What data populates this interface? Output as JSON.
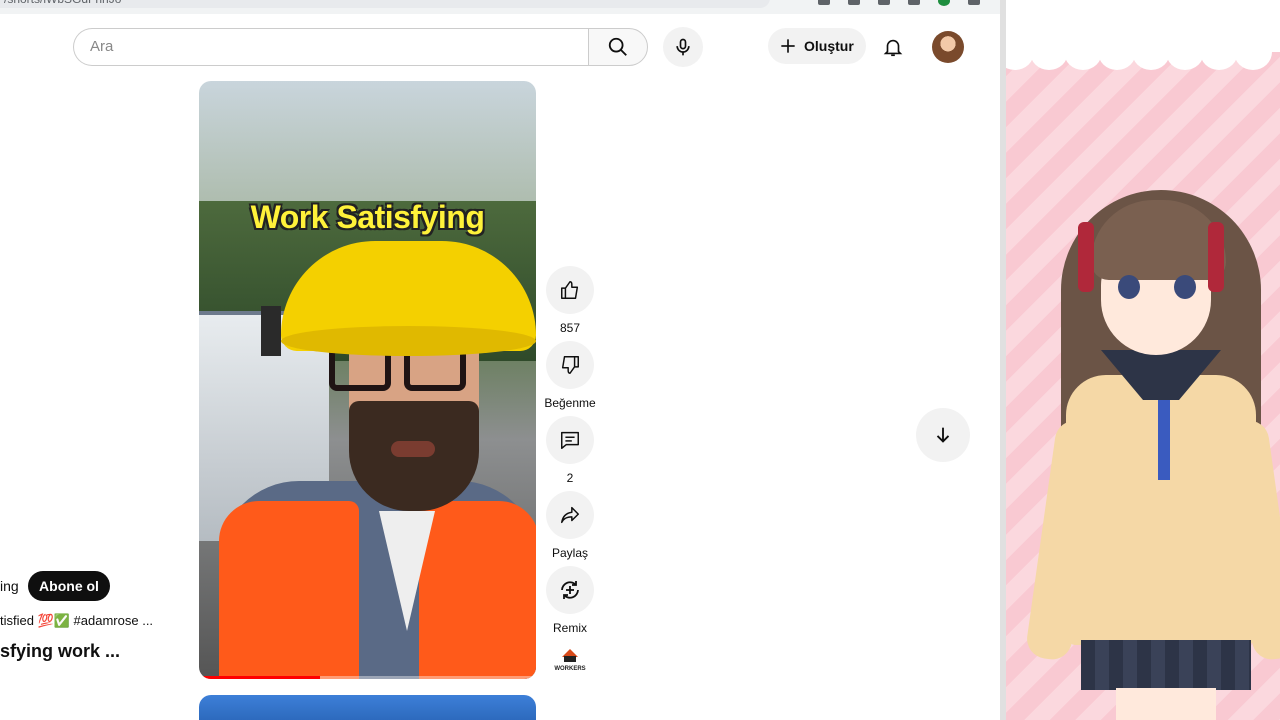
{
  "browser": {
    "url": "/shorts/lWbSGdFhhJo"
  },
  "header": {
    "search_placeholder": "Ara",
    "create_label": "Oluştur",
    "icons": [
      "search-icon",
      "mic-icon",
      "plus-icon",
      "bell-icon",
      "avatar"
    ]
  },
  "video": {
    "caption": "Work Satisfying",
    "progress_fraction": 0.36
  },
  "actions": {
    "like_count": "857",
    "dislike_label": "Beğenme",
    "comment_count": "2",
    "share_label": "Paylaş",
    "remix_label": "Remix",
    "channel_logo": "WORKERS"
  },
  "overlay": {
    "channel_name_partial": "ing",
    "subscribe_label": "Abone ol",
    "description_partial": "tisfied 💯✅ #adamrose ...",
    "title_partial": "sfying work ..."
  },
  "colors": {
    "accent_red": "#ff0000",
    "subscribe_bg": "#0f0f0f",
    "caption_yellow": "#fff23a",
    "panel_pink": "#f9c9d2"
  }
}
